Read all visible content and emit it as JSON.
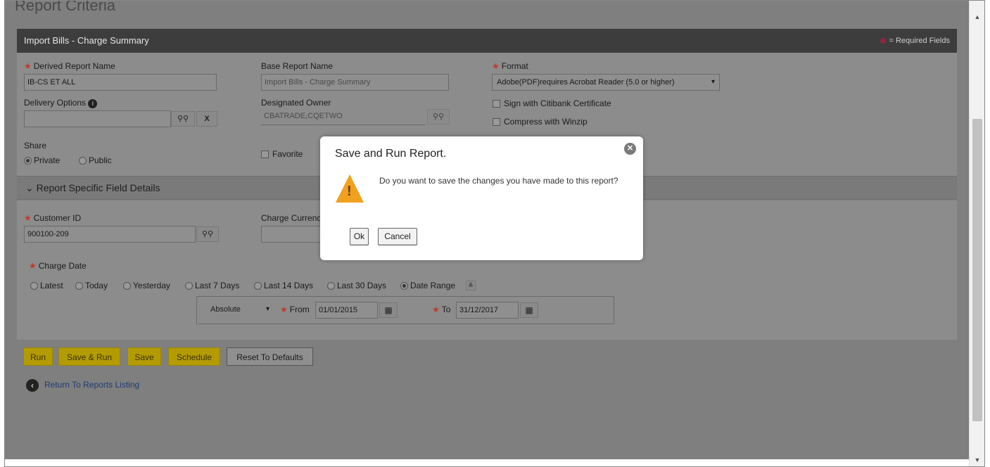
{
  "page": {
    "heading": "Report Criteria"
  },
  "panel": {
    "title": "Import Bills - Charge Summary",
    "required_legend": "= Required Fields"
  },
  "fields": {
    "derived_report_name": {
      "label": "Derived Report Name",
      "value": "IB-CS ET ALL"
    },
    "base_report_name": {
      "label": "Base Report Name",
      "value": "Import Bills - Charge Summary"
    },
    "format": {
      "label": "Format",
      "value": "Adobe(PDF)requires Acrobat Reader (5.0 or higher)"
    },
    "delivery_options": {
      "label": "Delivery Options",
      "value": "",
      "clear_label": "X"
    },
    "designated_owner": {
      "label": "Designated Owner",
      "value": "CBATRADE,CQETWO"
    },
    "sign_certificate": {
      "label": "Sign with Citibank Certificate"
    },
    "compress_winzip": {
      "label": "Compress with Winzip"
    },
    "share": {
      "label": "Share",
      "options": [
        "Private",
        "Public"
      ],
      "selected": "Private"
    },
    "favorite": {
      "label": "Favorite"
    }
  },
  "section": {
    "title": "Report Specific Field Details"
  },
  "specific": {
    "customer_id": {
      "label": "Customer ID",
      "value": "900100-209"
    },
    "charge_currency": {
      "label": "Charge Currency",
      "value": ""
    },
    "charge_date": {
      "label": "Charge Date",
      "options": [
        "Latest",
        "Today",
        "Yesterday",
        "Last 7 Days",
        "Last 14 Days",
        "Last 30 Days",
        "Date Range"
      ],
      "selected": "Date Range",
      "mode": "Absolute",
      "from_label": "From",
      "from": "01/01/2015",
      "to_label": "To",
      "to": "31/12/2017"
    }
  },
  "actions": {
    "run": "Run",
    "save_run": "Save & Run",
    "save": "Save",
    "schedule": "Schedule",
    "reset": "Reset To Defaults",
    "return_link": "Return To Reports Listing"
  },
  "modal": {
    "title": "Save and Run Report.",
    "message": "Do you want to save the changes you have made to this report?",
    "ok": "Ok",
    "cancel": "Cancel"
  },
  "icons": {
    "binoculars": "binoculars-icon",
    "calendar": "calendar-icon",
    "warning": "warning-icon",
    "close": "close-icon",
    "info": "info-icon",
    "back": "back-arrow-icon"
  },
  "colors": {
    "action_button": "#b39b00",
    "panel_header": "#3d3d3d",
    "warning": "#f0a21f",
    "required_star": "#c0392b"
  }
}
